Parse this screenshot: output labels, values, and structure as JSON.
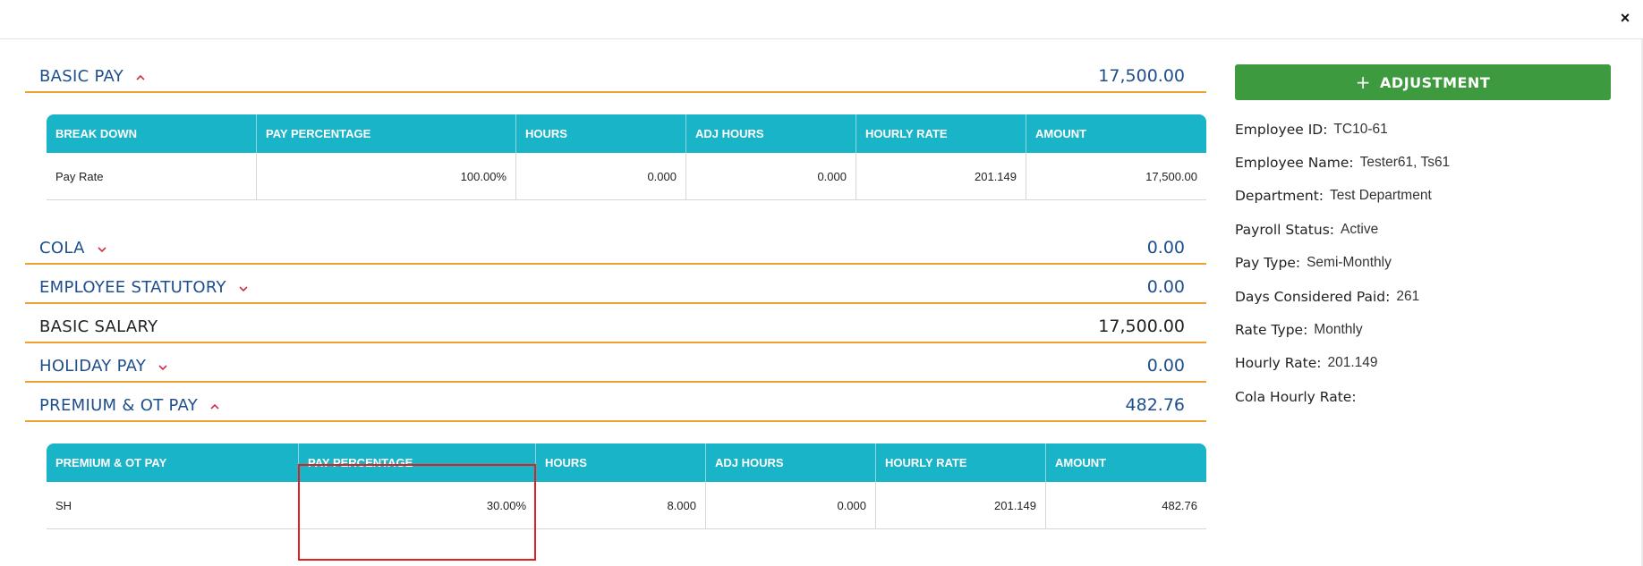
{
  "close_glyph": "×",
  "sections": {
    "basic_pay": {
      "title": "BASIC PAY",
      "amount": "17,500.00",
      "expanded": true
    },
    "cola": {
      "title": "COLA",
      "amount": "0.00",
      "expanded": false
    },
    "employee_statutory": {
      "title": "EMPLOYEE STATUTORY",
      "amount": "0.00",
      "expanded": false
    },
    "basic_salary": {
      "title": "BASIC SALARY",
      "amount": "17,500.00"
    },
    "holiday_pay": {
      "title": "HOLIDAY PAY",
      "amount": "0.00",
      "expanded": false
    },
    "premium_ot_pay": {
      "title": "PREMIUM & OT PAY",
      "amount": "482.76",
      "expanded": true
    }
  },
  "basic_pay_table": {
    "headers": [
      "BREAK DOWN",
      "PAY PERCENTAGE",
      "HOURS",
      "ADJ HOURS",
      "HOURLY RATE",
      "AMOUNT"
    ],
    "rows": [
      [
        "Pay Rate",
        "100.00%",
        "0.000",
        "0.000",
        "201.149",
        "17,500.00"
      ]
    ]
  },
  "premium_table": {
    "headers": [
      "PREMIUM & OT PAY",
      "PAY PERCENTAGE",
      "HOURS",
      "ADJ HOURS",
      "HOURLY RATE",
      "AMOUNT"
    ],
    "rows": [
      [
        "SH",
        "30.00%",
        "8.000",
        "0.000",
        "201.149",
        "482.76"
      ]
    ]
  },
  "sidebar": {
    "adjustment_label": "ADJUSTMENT",
    "plus_glyph": "+",
    "info": [
      {
        "label": "Employee ID:",
        "value": "TC10-61"
      },
      {
        "label": "Employee Name:",
        "value": "Tester61, Ts61"
      },
      {
        "label": "Department:",
        "value": "Test Department"
      },
      {
        "label": "Payroll Status:",
        "value": "Active"
      },
      {
        "label": "Pay Type:",
        "value": "Semi-Monthly"
      },
      {
        "label": "Days Considered Paid:",
        "value": "261"
      },
      {
        "label": "Rate Type:",
        "value": "Monthly"
      },
      {
        "label": "Hourly Rate:",
        "value": "201.149"
      },
      {
        "label": "Cola Hourly Rate:",
        "value": ""
      }
    ]
  },
  "colors": {
    "accent_orange": "#f0a030",
    "table_header": "#1ab4c8",
    "title_blue": "#1f4e8c",
    "button_green": "#3e9a3e",
    "chevron_red": "#d0304a",
    "highlight_red": "#e02020"
  }
}
